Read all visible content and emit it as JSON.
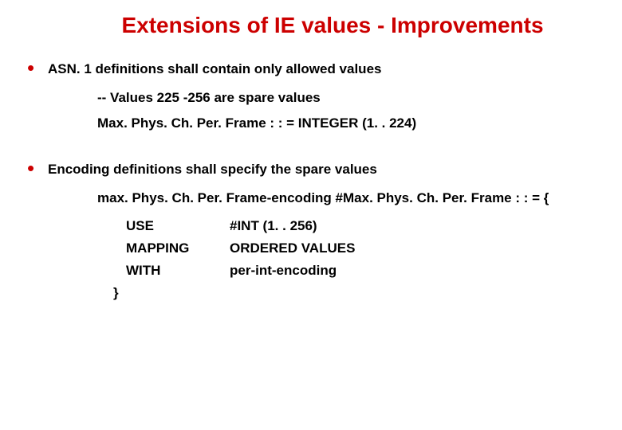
{
  "title": "Extensions of IE values - Improvements",
  "bullets": [
    {
      "text": "ASN. 1 definitions shall contain only allowed values",
      "sub": [
        "-- Values 225 -256 are spare values",
        "Max. Phys. Ch. Per. Frame : : = INTEGER (1. . 224)"
      ]
    },
    {
      "text": "Encoding definitions shall specify the spare values",
      "code_open": "max. Phys. Ch. Per. Frame-encoding #Max. Phys. Ch. Per. Frame : : = {",
      "table": [
        {
          "k": "USE",
          "v": "#INT (1. . 256)"
        },
        {
          "k": "MAPPING",
          "v": "ORDERED VALUES"
        },
        {
          "k": "WITH",
          "v": "per-int-encoding"
        }
      ],
      "code_close": "}"
    }
  ]
}
